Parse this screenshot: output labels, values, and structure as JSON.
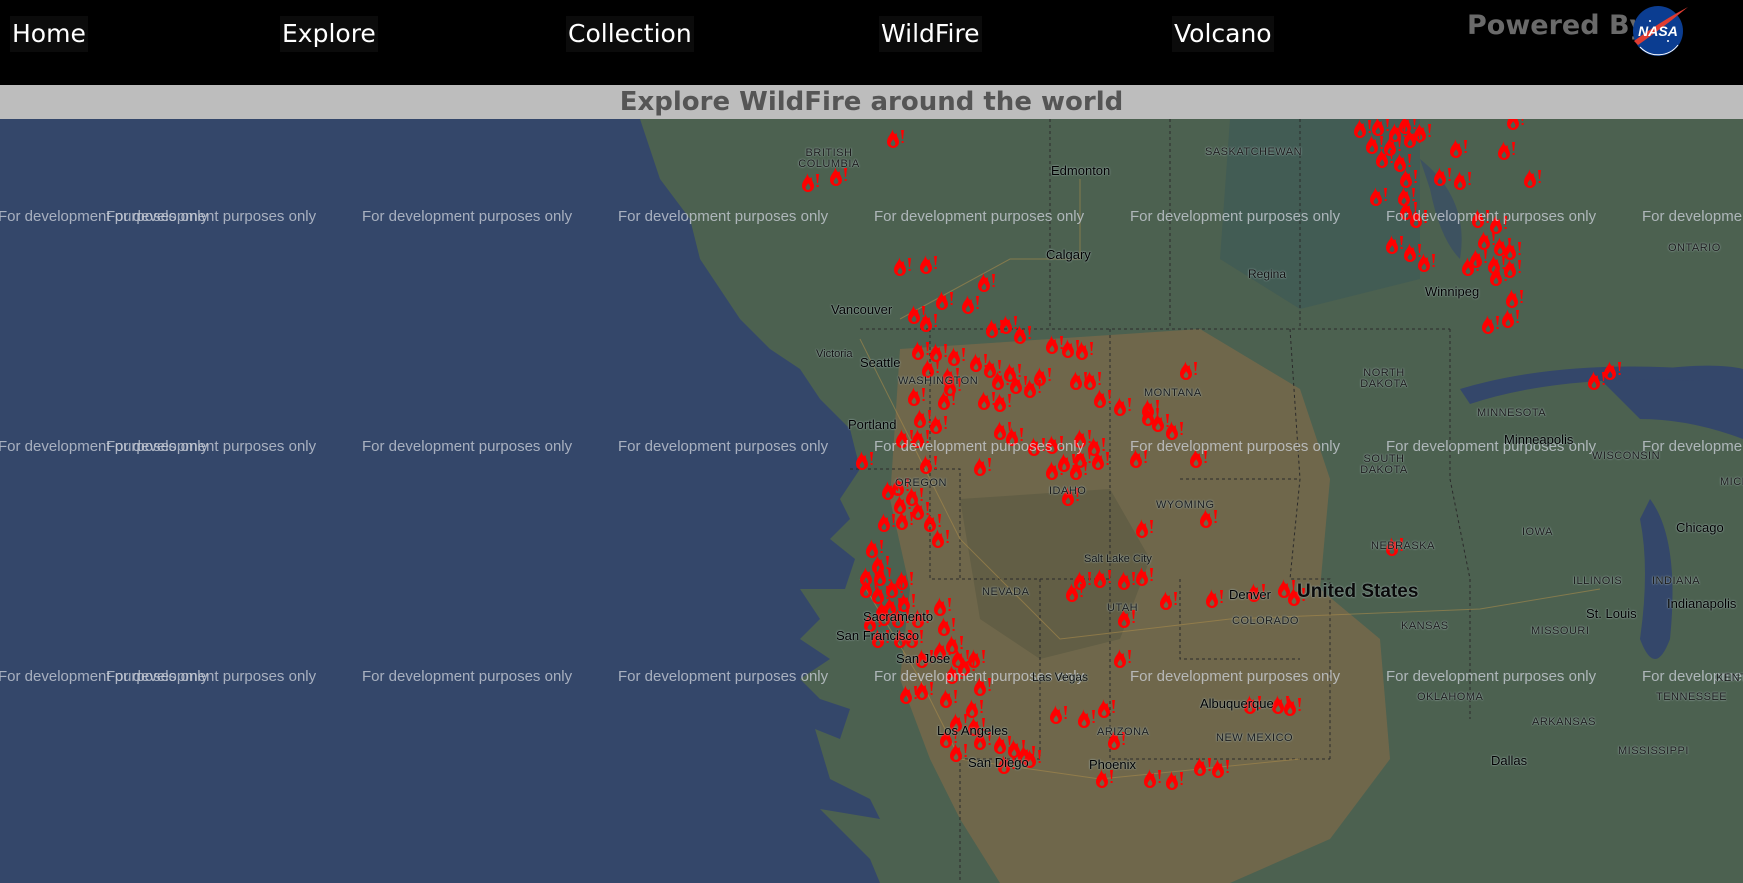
{
  "nav": {
    "items": [
      {
        "label": "Home"
      },
      {
        "label": "Explore"
      },
      {
        "label": "Collection"
      },
      {
        "label": "WildFire"
      },
      {
        "label": "Volcano"
      }
    ],
    "powered_by": "Powered By",
    "logo_text": "NASA"
  },
  "banner": {
    "title": "Explore WildFire around the world"
  },
  "map": {
    "watermark": "For development purposes only",
    "fire_color": "#ff0000",
    "ocean_color": "#34476a",
    "labels": {
      "british_columbia": "BRITISH COLUMBIA",
      "edmonton": "Edmonton",
      "saskatchewan": "SASKATCHEWAN",
      "calgary": "Calgary",
      "regina": "Regina",
      "winnipeg": "Winnipeg",
      "ontario": "ONTARIO",
      "vancouver": "Vancouver",
      "victoria": "Victoria",
      "seattle": "Seattle",
      "washington": "WASHINGTON",
      "portland": "Portland",
      "montana": "MONTANA",
      "north_dakota": "NORTH DAKOTA",
      "minnesota": "MINNESOTA",
      "minneapolis": "Minneapolis",
      "south_dakota": "SOUTH DAKOTA",
      "wisconsin": "WISCONSIN",
      "oregon": "OREGON",
      "idaho": "IDAHO",
      "wyoming": "WYOMING",
      "salt_lake_city": "Salt Lake City",
      "nebraska": "NEBRASKA",
      "iowa": "IOWA",
      "chicago": "Chicago",
      "nevada": "NEVADA",
      "utah": "UTAH",
      "denver": "Denver",
      "united_states": "United States",
      "colorado": "COLORADO",
      "illinois": "ILLINOIS",
      "indiana": "INDIANA",
      "indianapolis": "Indianapolis",
      "sacramento": "Sacramento",
      "san_francisco": "San Francisco",
      "san_jose": "San Jose",
      "kansas": "KANSAS",
      "missouri": "MISSOURI",
      "st_louis": "St. Louis",
      "las_vegas": "Las Vegas",
      "oklahoma": "OKLAHOMA",
      "tennessee": "TENNESSEE",
      "albuquerque": "Albuquerque",
      "los_angeles": "Los Angeles",
      "arizona": "ARIZONA",
      "new_mexico": "NEW MEXICO",
      "arkansas": "ARKANSAS",
      "mississippi": "MISSISSIPPI",
      "phoenix": "Phoenix",
      "san_diego": "San Diego",
      "dallas": "Dallas",
      "michigan": "MICHI",
      "kentucky": "KENTU"
    }
  }
}
